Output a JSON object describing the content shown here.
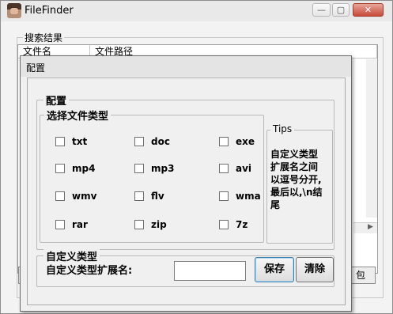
{
  "main_window": {
    "title": "FileFinder",
    "min_glyph": "—",
    "max_glyph": "▢",
    "close_glyph": "✕",
    "results_group_label": "搜索结果",
    "columns": [
      "文件名",
      "文件路径"
    ],
    "right_button_label": "包"
  },
  "config_dialog": {
    "title": "配置",
    "group_label": "配置",
    "file_types_label": "选择文件类型",
    "file_types": [
      [
        "txt",
        "doc",
        "exe"
      ],
      [
        "mp4",
        "mp3",
        "avi"
      ],
      [
        "wmv",
        "flv",
        "wma"
      ],
      [
        "rar",
        "zip",
        "7z"
      ]
    ],
    "tips_label": "Tips",
    "tips_text": "自定义类型扩展名之间以逗号分开,最后以,\\n结尾",
    "custom_group_label": "自定义类型",
    "custom_ext_label": "自定义类型扩展名:",
    "custom_ext_value": "",
    "save_label": "保存",
    "clear_label": "清除"
  }
}
